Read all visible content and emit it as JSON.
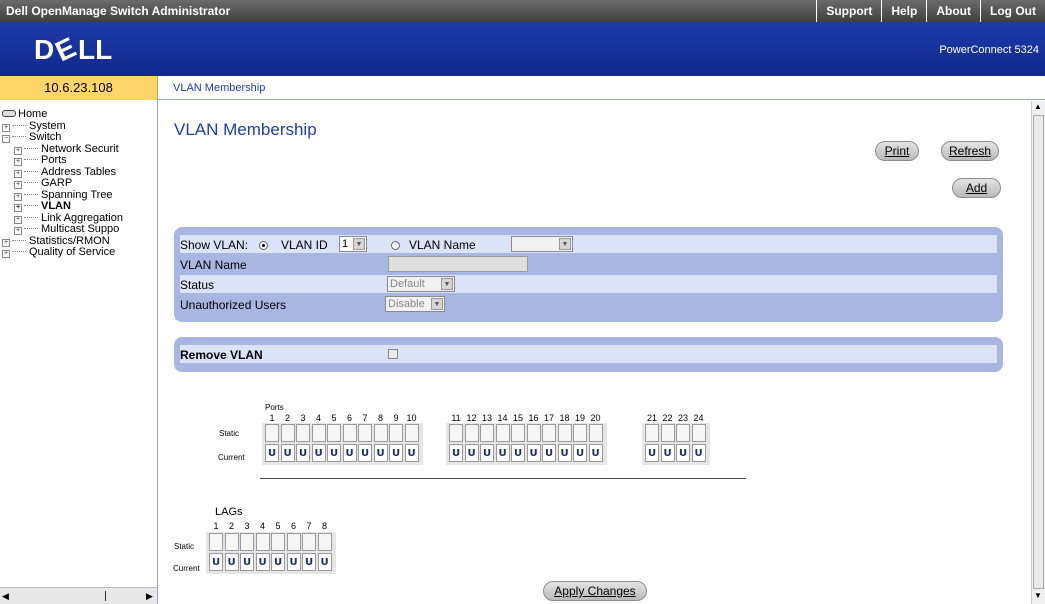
{
  "topbar": {
    "title": "Dell OpenManage Switch Administrator",
    "links": [
      "Support",
      "Help",
      "About",
      "Log Out"
    ]
  },
  "brand": {
    "logo": "DELL",
    "product": "PowerConnect 5324"
  },
  "ip": "10.6.23.108",
  "breadcrumb": "VLAN Membership",
  "sidebar": {
    "items": [
      {
        "label": "Home",
        "level": 0
      },
      {
        "label": "System",
        "level": 1
      },
      {
        "label": "Switch",
        "level": 1
      },
      {
        "label": "Network Securit",
        "level": 2
      },
      {
        "label": "Ports",
        "level": 2
      },
      {
        "label": "Address Tables",
        "level": 2
      },
      {
        "label": "GARP",
        "level": 2
      },
      {
        "label": "Spanning Tree",
        "level": 2
      },
      {
        "label": "VLAN",
        "level": 2,
        "selected": true
      },
      {
        "label": "Link Aggregation",
        "level": 2
      },
      {
        "label": "Multicast Suppo",
        "level": 2
      },
      {
        "label": "Statistics/RMON",
        "level": 1
      },
      {
        "label": "Quality of Service",
        "level": 1
      }
    ]
  },
  "page": {
    "title": "VLAN Membership",
    "buttons": {
      "print": "Print",
      "refresh": "Refresh",
      "add": "Add",
      "apply": "Apply Changes"
    }
  },
  "form": {
    "show_vlan_label": "Show VLAN:",
    "vlan_id_label": "VLAN ID",
    "vlan_id_value": "1",
    "vlan_name_radio_label": "VLAN Name",
    "vlan_name_label": "VLAN Name",
    "status_label": "Status",
    "status_value": "Default",
    "unauth_label": "Unauthorized Users",
    "unauth_value": "Disable",
    "remove_label": "Remove VLAN"
  },
  "ports": {
    "heading": "Ports",
    "numbers": [
      "1",
      "2",
      "3",
      "4",
      "5",
      "6",
      "7",
      "8",
      "9",
      "10",
      "11",
      "12",
      "13",
      "14",
      "15",
      "16",
      "17",
      "18",
      "19",
      "20",
      "21",
      "22",
      "23",
      "24"
    ],
    "static_label": "Static",
    "current_label": "Current",
    "current_value": "U"
  },
  "lags": {
    "heading": "LAGs",
    "numbers": [
      "1",
      "2",
      "3",
      "4",
      "5",
      "6",
      "7",
      "8"
    ],
    "static_label": "Static",
    "current_label": "Current",
    "current_value": "U"
  }
}
